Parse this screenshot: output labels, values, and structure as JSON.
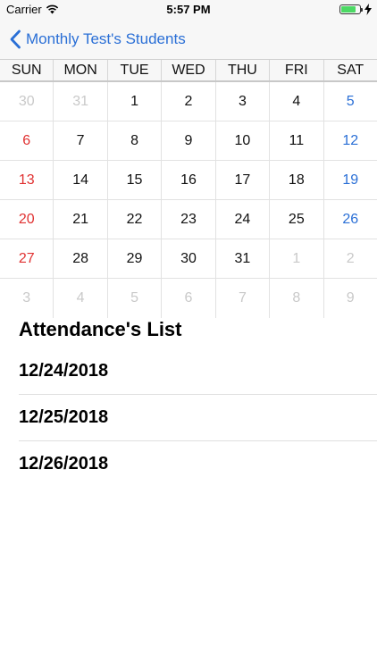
{
  "status_bar": {
    "carrier": "Carrier",
    "time": "5:57 PM",
    "battery_color": "#4cd964"
  },
  "nav": {
    "back_label": "Monthly Test's Students",
    "accent": "#2a6fd6"
  },
  "calendar": {
    "weekdays": [
      "SUN",
      "MON",
      "TUE",
      "WED",
      "THU",
      "FRI",
      "SAT"
    ],
    "weeks": [
      [
        {
          "d": "30",
          "o": true
        },
        {
          "d": "31",
          "o": true
        },
        {
          "d": "1"
        },
        {
          "d": "2"
        },
        {
          "d": "3"
        },
        {
          "d": "4"
        },
        {
          "d": "5"
        }
      ],
      [
        {
          "d": "6"
        },
        {
          "d": "7"
        },
        {
          "d": "8"
        },
        {
          "d": "9"
        },
        {
          "d": "10"
        },
        {
          "d": "11"
        },
        {
          "d": "12"
        }
      ],
      [
        {
          "d": "13"
        },
        {
          "d": "14"
        },
        {
          "d": "15"
        },
        {
          "d": "16"
        },
        {
          "d": "17"
        },
        {
          "d": "18"
        },
        {
          "d": "19"
        }
      ],
      [
        {
          "d": "20"
        },
        {
          "d": "21"
        },
        {
          "d": "22"
        },
        {
          "d": "23"
        },
        {
          "d": "24"
        },
        {
          "d": "25"
        },
        {
          "d": "26"
        }
      ],
      [
        {
          "d": "27"
        },
        {
          "d": "28"
        },
        {
          "d": "29"
        },
        {
          "d": "30"
        },
        {
          "d": "31"
        },
        {
          "d": "1",
          "o": true
        },
        {
          "d": "2",
          "o": true
        }
      ],
      [
        {
          "d": "3",
          "o": true
        },
        {
          "d": "4",
          "o": true
        },
        {
          "d": "5",
          "o": true
        },
        {
          "d": "6",
          "o": true
        },
        {
          "d": "7",
          "o": true
        },
        {
          "d": "8",
          "o": true
        },
        {
          "d": "9",
          "o": true
        }
      ]
    ],
    "sunday_color": "#e03131",
    "saturday_color": "#2a6fd6",
    "other_month_color": "#c9c9c9"
  },
  "attendance": {
    "title": "Attendance's List",
    "dates": [
      "12/24/2018",
      "12/25/2018",
      "12/26/2018"
    ]
  }
}
